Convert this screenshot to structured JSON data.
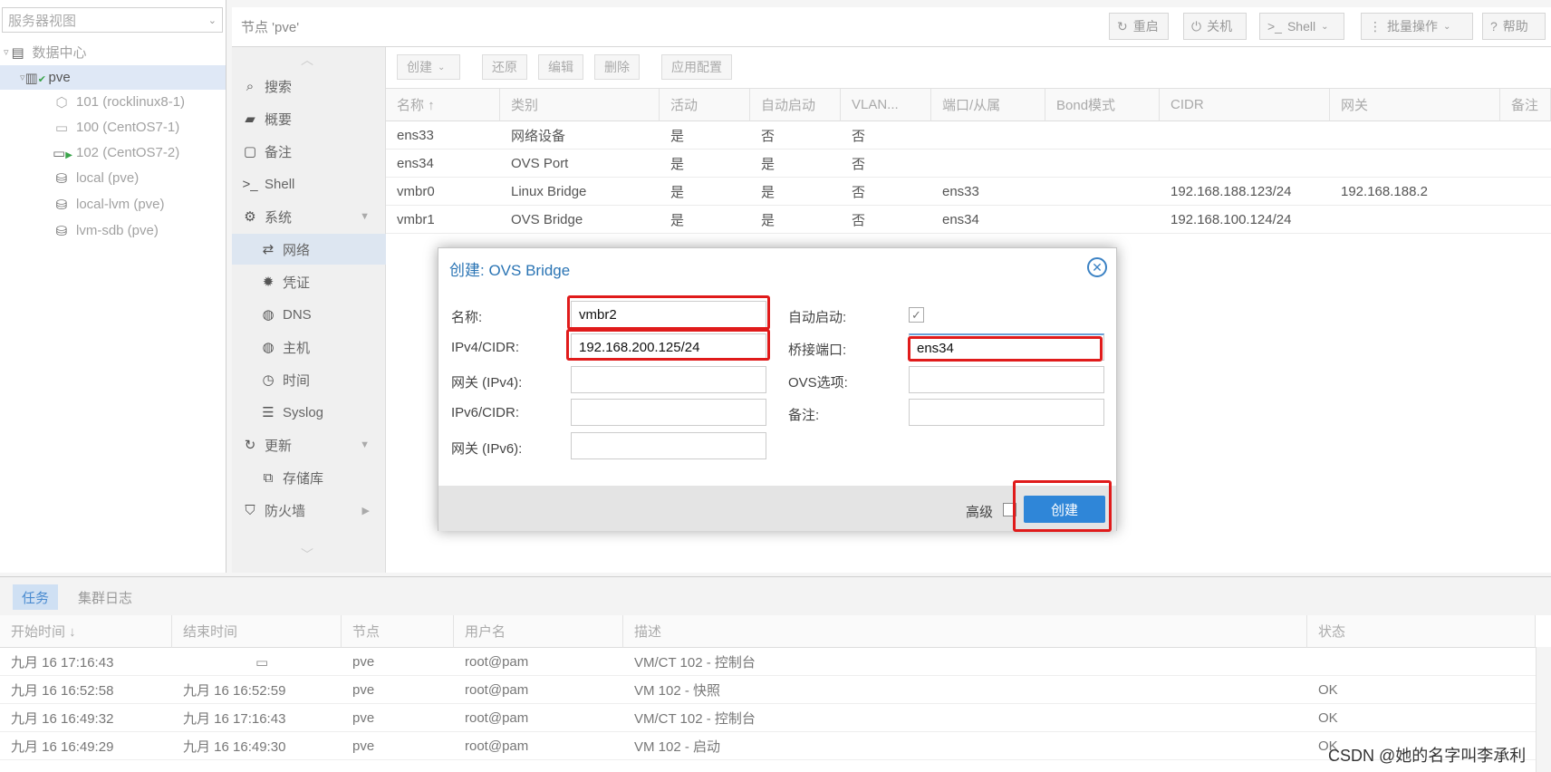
{
  "tree": {
    "view_label": "服务器视图",
    "datacenter": "数据中心",
    "node": "pve",
    "items": [
      {
        "label": "101 (rocklinux8-1)",
        "icon": "container-icon"
      },
      {
        "label": "100 (CentOS7-1)",
        "icon": "vm-icon"
      },
      {
        "label": "102 (CentOS7-2)",
        "icon": "vm-running-icon"
      },
      {
        "label": "local (pve)",
        "icon": "storage-icon"
      },
      {
        "label": "local-lvm (pve)",
        "icon": "storage-icon"
      },
      {
        "label": "lvm-sdb (pve)",
        "icon": "storage-icon"
      }
    ]
  },
  "header": {
    "title": "节点 'pve'",
    "reboot": "重启",
    "shutdown": "关机",
    "shell": "Shell",
    "bulk": "批量操作",
    "help": "帮助"
  },
  "nav": {
    "search": "搜索",
    "summary": "概要",
    "notes": "备注",
    "shell": "Shell",
    "system": "系统",
    "network": "网络",
    "certificates": "凭证",
    "dns": "DNS",
    "hosts": "主机",
    "time": "时间",
    "syslog": "Syslog",
    "updates": "更新",
    "repositories": "存储库",
    "firewall": "防火墙"
  },
  "toolbar": {
    "create": "创建",
    "revert": "还原",
    "edit": "编辑",
    "remove": "删除",
    "apply": "应用配置"
  },
  "network_table": {
    "columns": [
      "名称 ↑",
      "类别",
      "活动",
      "自动启动",
      "VLAN...",
      "端口/从属",
      "Bond模式",
      "CIDR",
      "网关",
      "备注"
    ],
    "rows": [
      [
        "ens33",
        "网络设备",
        "是",
        "否",
        "否",
        "",
        "",
        "",
        ""
      ],
      [
        "ens34",
        "OVS Port",
        "是",
        "是",
        "否",
        "",
        "",
        "",
        ""
      ],
      [
        "vmbr0",
        "Linux Bridge",
        "是",
        "是",
        "否",
        "ens33",
        "",
        "192.168.188.123/24",
        "192.168.188.2"
      ],
      [
        "vmbr1",
        "OVS Bridge",
        "是",
        "是",
        "否",
        "ens34",
        "",
        "192.168.100.124/24",
        ""
      ]
    ]
  },
  "dialog": {
    "title": "创建: OVS Bridge",
    "name_label": "名称:",
    "name_value": "vmbr2",
    "ipv4_label": "IPv4/CIDR:",
    "ipv4_value": "192.168.200.125/24",
    "gw4_label": "网关 (IPv4):",
    "gw4_value": "",
    "ipv6_label": "IPv6/CIDR:",
    "ipv6_value": "",
    "gw6_label": "网关 (IPv6):",
    "gw6_value": "",
    "autostart_label": "自动启动:",
    "autostart_checked": true,
    "ports_label": "桥接端口:",
    "ports_value": "ens34",
    "ovs_label": "OVS选项:",
    "ovs_value": "",
    "comment_label": "备注:",
    "comment_value": "",
    "advanced_label": "高级",
    "create_button": "创建",
    "close_glyph": "✕"
  },
  "log": {
    "tab_tasks": "任务",
    "tab_cluster": "集群日志",
    "columns": [
      "开始时间 ↓",
      "结束时间",
      "节点",
      "用户名",
      "描述",
      "状态"
    ],
    "rows": [
      [
        "九月 16 17:16:43",
        "",
        "pve",
        "root@pam",
        "VM/CT 102 - 控制台",
        ""
      ],
      [
        "九月 16 16:52:58",
        "九月 16 16:52:59",
        "pve",
        "root@pam",
        "VM 102 - 快照",
        "OK"
      ],
      [
        "九月 16 16:49:32",
        "九月 16 17:16:43",
        "pve",
        "root@pam",
        "VM/CT 102 - 控制台",
        "OK"
      ],
      [
        "九月 16 16:49:29",
        "九月 16 16:49:30",
        "pve",
        "root@pam",
        "VM 102 - 启动",
        "OK"
      ]
    ]
  },
  "watermark": "CSDN @她的名字叫李承利",
  "colors": {
    "accent": "#2f86d8",
    "highlight_red": "#e01b1b",
    "selection": "#dfe8f6"
  }
}
